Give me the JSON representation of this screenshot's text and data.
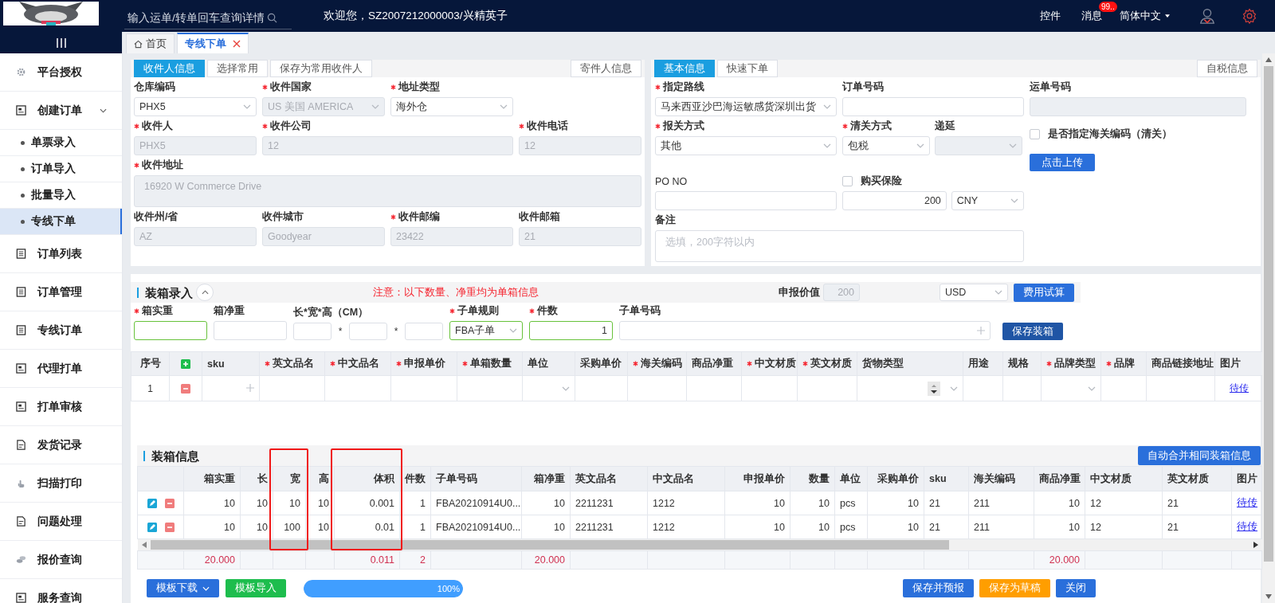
{
  "top_bar": {
    "search": {
      "placeholder": "输入运单/转单回车查询详情"
    },
    "welcome": "欢迎您，SZ2007212000003/兴精英子",
    "links": [
      "控件"
    ],
    "messages": {
      "label": "消息",
      "badge": "99.."
    },
    "language": "简体中文"
  },
  "sidebar": {
    "items": [
      {
        "label": "平台授权",
        "selected": false
      },
      {
        "label": "创建订单",
        "selected": false,
        "expanded": true,
        "children": [
          {
            "label": "单票录入",
            "selected": false
          },
          {
            "label": "订单导入",
            "selected": false
          },
          {
            "label": "批量导入",
            "selected": false
          },
          {
            "label": "专线下单",
            "selected": true
          }
        ]
      },
      {
        "label": "订单列表",
        "selected": false
      },
      {
        "label": "订单管理",
        "selected": false
      },
      {
        "label": "专线订单",
        "selected": false
      },
      {
        "label": "代理打单",
        "selected": false
      },
      {
        "label": "打单审核",
        "selected": false
      },
      {
        "label": "发货记录",
        "selected": false
      },
      {
        "label": "扫描打印",
        "selected": false
      },
      {
        "label": "问题处理",
        "selected": false
      },
      {
        "label": "报价查询",
        "selected": false
      },
      {
        "label": "服务查询",
        "selected": false
      }
    ]
  },
  "tabs": [
    {
      "label": "首页",
      "selected": false,
      "closable": false
    },
    {
      "label": "专线下单",
      "selected": true,
      "closable": true
    }
  ],
  "recipient": {
    "tabs": [
      {
        "label": "收件人信息",
        "selected": true
      },
      {
        "label": "选择常用",
        "selected": false
      },
      {
        "label": "保存为常用收件人",
        "selected": false
      }
    ],
    "side_button": "寄件人信息",
    "rows": [
      [
        {
          "label": "仓库编码",
          "required": false,
          "kind": "select",
          "value": "PHX5",
          "disabled": false
        },
        {
          "label": "收件国家",
          "required": true,
          "kind": "select",
          "value": "US 美国 AMERICA",
          "disabled": true
        },
        {
          "label": "地址类型",
          "required": true,
          "kind": "select",
          "value": "海外仓",
          "disabled": false
        }
      ],
      [
        {
          "label": "收件人",
          "required": true,
          "kind": "input",
          "value": "PHX5",
          "disabled": true
        },
        {
          "label": "收件公司",
          "required": true,
          "kind": "input",
          "value": "12",
          "disabled": true
        },
        "",
        {
          "label": "收件电话",
          "required": true,
          "kind": "input",
          "value": "12",
          "disabled": true
        }
      ],
      [
        {
          "label": "收件地址",
          "required": true,
          "kind": "textarea",
          "value": "16920 W Commerce Drive",
          "disabled": true
        }
      ],
      [
        {
          "label": "收件州/省",
          "required": false,
          "kind": "input",
          "value": "AZ",
          "disabled": true
        },
        {
          "label": "收件城市",
          "required": false,
          "kind": "input",
          "value": "Goodyear",
          "disabled": true
        },
        {
          "label": "收件邮编",
          "required": true,
          "kind": "input",
          "value": "23422",
          "disabled": true
        },
        {
          "label": "收件邮箱",
          "required": false,
          "kind": "input",
          "value": "21",
          "disabled": true
        }
      ]
    ]
  },
  "basic": {
    "tabs": [
      {
        "label": "基本信息",
        "selected": true
      },
      {
        "label": "快速下单",
        "selected": false
      }
    ],
    "side_button": "自税信息",
    "route": {
      "label": "指定路线",
      "required": true,
      "kind": "select",
      "value": "马来西亚沙巴海运敏感货深圳出货",
      "disabled": false
    },
    "order_no": {
      "label": "订单号码",
      "required": false,
      "kind": "input",
      "disabled": false
    },
    "waybill_no": {
      "label": "运单号码",
      "required": false,
      "kind": "input",
      "disabled": true
    },
    "declare_method": {
      "label": "报关方式",
      "required": true,
      "kind": "select",
      "value": "其他",
      "disabled": false
    },
    "clearance": {
      "label": "清关方式",
      "required": true,
      "kind": "select",
      "value": "包税",
      "disabled": false
    },
    "deferral": {
      "label": "递延",
      "required": false,
      "kind": "select",
      "disabled": true
    },
    "customs_code": {
      "label": "是否指定海关编码（清关）",
      "checked": false
    },
    "po_no": {
      "label": "PO NO",
      "required": false,
      "kind": "input",
      "disabled": false
    },
    "insurance": {
      "label": "购买保险",
      "checked": false,
      "amount": "200",
      "currency": "CNY"
    },
    "upload_button": "点击上传",
    "remarks": {
      "label": "备注",
      "required": false,
      "kind": "textarea",
      "placeholder": "选填，200字符以内",
      "disabled": false
    }
  },
  "packing_entry": {
    "title": "装箱录入",
    "collapsed": false,
    "note": "注意：以下数量、净重均为单箱信息",
    "declared_value": {
      "label": "申报价值",
      "value": "200"
    },
    "currency": "USD",
    "calc_button": "费用试算",
    "fields": [
      {
        "label": "箱实重",
        "required": true,
        "kind": "input",
        "valid": true
      },
      {
        "label": "箱净重",
        "required": false,
        "kind": "input",
        "valid": false
      },
      {
        "label": "长*宽*高（CM）",
        "required": false,
        "kind": "dims",
        "separators": [
          "*",
          "*"
        ],
        "valid": false
      },
      {
        "label": "子单规则",
        "required": true,
        "kind": "select",
        "value": "FBA子单",
        "valid": true
      },
      {
        "label": "件数",
        "required": true,
        "kind": "number",
        "value": "1",
        "valid": true
      },
      {
        "label": "子单号码",
        "required": false,
        "kind": "add-input",
        "valid": false
      }
    ],
    "save_button": "保存装箱"
  },
  "items_table": {
    "columns": [
      {
        "label": "序号",
        "required": false
      },
      {
        "kind": "add"
      },
      {
        "label": "sku",
        "required": false
      },
      {
        "label": "英文品名",
        "required": true
      },
      {
        "label": "中文品名",
        "required": true
      },
      {
        "label": "申报单价",
        "required": true
      },
      {
        "label": "单箱数量",
        "required": true
      },
      {
        "label": "单位",
        "required": false
      },
      {
        "label": "采购单价",
        "required": false
      },
      {
        "label": "海关编码",
        "required": true
      },
      {
        "label": "商品净重",
        "required": false
      },
      {
        "label": "中文材质",
        "required": true
      },
      {
        "label": "英文材质",
        "required": true
      },
      {
        "label": "货物类型",
        "required": false
      },
      {
        "label": "用途",
        "required": false
      },
      {
        "label": "规格",
        "required": false
      },
      {
        "label": "品牌类型",
        "required": true
      },
      {
        "label": "品牌",
        "required": true
      },
      {
        "label": "商品链接地址",
        "required": false
      },
      {
        "label": "图片",
        "required": false
      }
    ],
    "rows": [
      {
        "cells": [
          {
            "kind": "text",
            "value": "1"
          },
          {
            "kind": "remove"
          },
          {
            "kind": "add-input"
          },
          {
            "kind": "blank"
          },
          {
            "kind": "blank"
          },
          {
            "kind": "blank"
          },
          {
            "kind": "blank"
          },
          {
            "kind": "select"
          },
          {
            "kind": "blank"
          },
          {
            "kind": "blank"
          },
          {
            "kind": "blank"
          },
          {
            "kind": "blank"
          },
          {
            "kind": "blank"
          },
          {
            "kind": "spinner-select"
          },
          {
            "kind": "blank"
          },
          {
            "kind": "blank"
          },
          {
            "kind": "select"
          },
          {
            "kind": "blank"
          },
          {
            "kind": "blank"
          },
          {
            "kind": "link",
            "value": "待传"
          }
        ]
      }
    ]
  },
  "packing_info": {
    "title": "装箱信息",
    "merge_button": "自动合并相同装箱信息",
    "columns": [
      {
        "label": "箱实重",
        "kind": "number",
        "total": "20.000"
      },
      {
        "label": "长",
        "kind": "number"
      },
      {
        "label": "宽",
        "kind": "number",
        "highlighted": true
      },
      {
        "label": "高",
        "kind": "number"
      },
      {
        "label": "体积",
        "kind": "number",
        "highlighted": true,
        "total": "0.011"
      },
      {
        "label": "件数",
        "kind": "number",
        "total": "2"
      },
      {
        "label": "子单号码",
        "kind": "text"
      },
      {
        "label": "箱净重",
        "kind": "number",
        "total": "20.000"
      },
      {
        "label": "英文品名",
        "kind": "text"
      },
      {
        "label": "中文品名",
        "kind": "text"
      },
      {
        "label": "申报单价",
        "kind": "number"
      },
      {
        "label": "数量",
        "kind": "number"
      },
      {
        "label": "单位",
        "kind": "text"
      },
      {
        "label": "采购单价",
        "kind": "number"
      },
      {
        "label": "sku",
        "kind": "text"
      },
      {
        "label": "海关编码",
        "kind": "text"
      },
      {
        "label": "商品净重",
        "kind": "number",
        "total": "20.000"
      },
      {
        "label": "中文材质",
        "kind": "text"
      },
      {
        "label": "英文材质",
        "kind": "text"
      },
      {
        "label": "图片",
        "kind": "link"
      }
    ],
    "rows": [
      {
        "values": [
          "10",
          "10",
          "10",
          "10",
          "0.001",
          "1",
          "FBA20210914U0...",
          "10",
          "2211231",
          "1212",
          "10",
          "10",
          "pcs",
          "10",
          "21",
          "211",
          "10",
          "12",
          "21",
          "待传"
        ]
      },
      {
        "values": [
          "10",
          "10",
          "100",
          "10",
          "0.01",
          "1",
          "FBA20210914U0...",
          "10",
          "2211231",
          "1212",
          "10",
          "10",
          "pcs",
          "10",
          "21",
          "211",
          "10",
          "12",
          "21",
          "待传"
        ]
      }
    ]
  },
  "footer": {
    "left_buttons": [
      {
        "label": "模板下载",
        "kind": "primary",
        "dropdown": true
      },
      {
        "label": "模板导入",
        "kind": "success",
        "dropdown": false
      }
    ],
    "progress": {
      "level": 1,
      "label": "100%"
    },
    "right_buttons": [
      {
        "label": "保存并预报",
        "kind": "primary"
      },
      {
        "label": "保存为草稿",
        "kind": "warning"
      },
      {
        "label": "关闭",
        "kind": "primary"
      }
    ]
  }
}
